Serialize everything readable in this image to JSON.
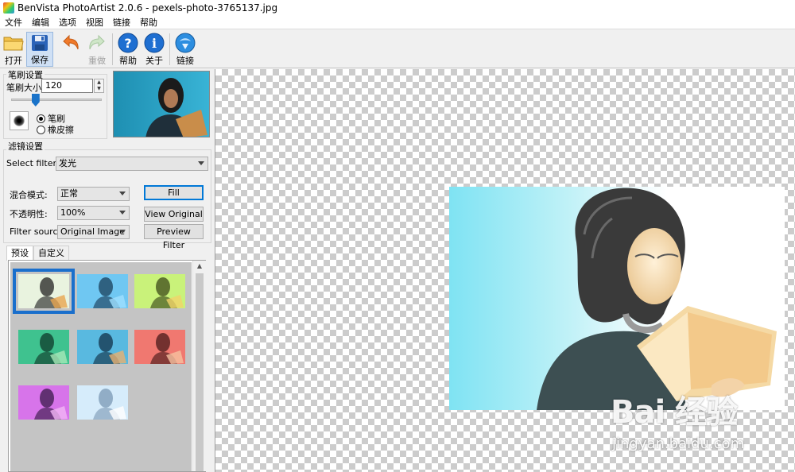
{
  "window": {
    "title": "BenVista PhotoArtist 2.0.6 - pexels-photo-3765137.jpg"
  },
  "menu": [
    "文件",
    "编辑",
    "选项",
    "视图",
    "链接",
    "帮助"
  ],
  "toolbar": {
    "open_label": "打开",
    "save_label": "保存",
    "undo_label": "",
    "redo_label": "重做",
    "help_label": "帮助",
    "about_label": "关于",
    "link_label": "链接"
  },
  "brush": {
    "group_title": "笔刷设置",
    "size_label": "笔刷大小:",
    "size_value": "120",
    "slider_level": 0.27,
    "option_brush": "笔刷",
    "option_eraser": "橡皮擦",
    "selected": "笔刷"
  },
  "filter": {
    "group_title": "滤镜设置",
    "select_filter_label": "Select filter:",
    "select_filter_value": "发光",
    "blend_label": "混合模式:",
    "blend_value": "正常",
    "opacity_label": "不透明性:",
    "opacity_value": "100%",
    "source_label": "Filter source:",
    "source_value": "Original Image",
    "fill_button": "Fill",
    "view_original_button": "View Original",
    "preview_filter_button": "Preview Filter"
  },
  "tabs": [
    "预设",
    "自定义"
  ],
  "active_tab": "预设",
  "presets": [
    {
      "name": "preset-1",
      "tint": "#e9f3df",
      "selected": true
    },
    {
      "name": "preset-2",
      "tint": "#6fc7f2"
    },
    {
      "name": "preset-3",
      "tint": "#c9f27a"
    },
    {
      "name": "preset-4",
      "tint": "#3fc28f"
    },
    {
      "name": "preset-5",
      "tint": "#59b9e0"
    },
    {
      "name": "preset-6",
      "tint": "#f07870"
    },
    {
      "name": "preset-7",
      "tint": "#d774ea"
    },
    {
      "name": "preset-8",
      "tint": "#d6ecfb"
    }
  ],
  "watermark": {
    "logo": "Bai 经验",
    "url": "jingyan.baidu.com"
  },
  "colors": {
    "accent": "#1a6fcc",
    "checker_light": "#ffffff",
    "checker_dark": "#cccccc"
  }
}
